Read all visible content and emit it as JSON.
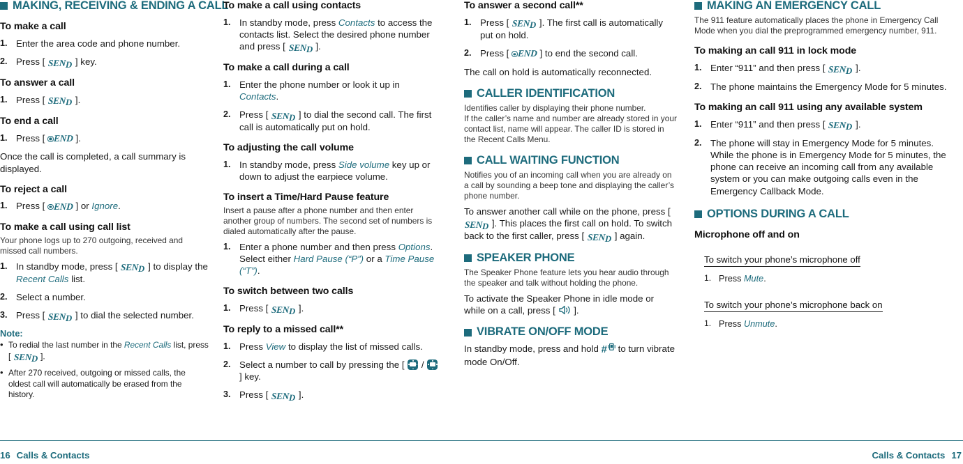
{
  "footer": {
    "page_left": "16",
    "chapter_left": "Calls & Contacts",
    "chapter_right": "Calls & Contacts",
    "page_right": "17"
  },
  "colors": {
    "accent": "#1d6b7c",
    "text": "#1a1a1a"
  },
  "col1": {
    "section_title": "MAKING, RECEIVING & ENDING A CALL",
    "h_make_call": "To make a call",
    "make_call_1": "Enter the area code and phone number.",
    "make_call_2_pre": "Press [",
    "make_call_2_post": "] key.",
    "h_answer_call": "To answer a call",
    "answer_call_1_pre": "Press [",
    "answer_call_1_post": "].",
    "h_end_call": "To end a call",
    "end_call_1_pre": "Press [",
    "end_call_1_post": "].",
    "end_call_note": "Once the call is completed, a call summary is displayed.",
    "h_reject_call": "To reject a call",
    "reject_call_1_pre": "Press [",
    "reject_call_1_mid": "] or ",
    "reject_call_1_term": "Ignore",
    "reject_call_1_post": ".",
    "h_call_list": "To make a call using call list",
    "call_list_intro": "Your phone logs up to 270 outgoing, received and missed call numbers.",
    "call_list_1_pre": "In standby mode, press [",
    "call_list_1_mid": "] to display the ",
    "call_list_1_term": "Recent Calls",
    "call_list_1_post": " list.",
    "call_list_2": "Select a number.",
    "call_list_3_pre": "Press [",
    "call_list_3_post": "] to dial the selected number.",
    "note_label": "Note:",
    "note_1_pre": "To redial the last number in the ",
    "note_1_term": "Recent Calls",
    "note_1_mid": " list, press [",
    "note_1_post": "].",
    "note_2": "After 270 received, outgoing or missed calls, the oldest call will automatically be erased from the history."
  },
  "col2": {
    "h_contacts": "To make a call using contacts",
    "contacts_1_pre": "In standby mode, press ",
    "contacts_1_term": "Contacts",
    "contacts_1_mid": " to access the contacts list. Select the desired phone number and press [",
    "contacts_1_post": "].",
    "h_during_call": "To make a call during a call",
    "during_1_pre": "Enter the phone number or look it up in ",
    "during_1_term": "Contacts",
    "during_1_post": ".",
    "during_2_pre": "Press [",
    "during_2_post": "] to dial the second call. The first call is automatically put on hold.",
    "h_volume": "To adjusting the call volume",
    "volume_1_pre": "In standby mode, press ",
    "volume_1_term": "Side volume",
    "volume_1_post": " key up or down to adjust the earpiece volume.",
    "h_pause": "To insert a Time/Hard Pause feature",
    "pause_intro": "Insert a pause after a phone number and then enter another group of numbers. The second set of numbers is dialed automatically after the pause.",
    "pause_1_pre": "Enter a phone number and then press ",
    "pause_1_term1": "Options",
    "pause_1_mid1": ". Select either ",
    "pause_1_term2": "Hard Pause (“P”)",
    "pause_1_mid2": " or a ",
    "pause_1_term3": "Time Pause (“T”)",
    "pause_1_post": ".",
    "h_switch": "To switch between two calls",
    "switch_1_pre": "Press [",
    "switch_1_post": "].",
    "h_missed": "To reply to a missed call**",
    "missed_1_pre": "Press ",
    "missed_1_term": "View",
    "missed_1_post": " to display the list of missed calls.",
    "missed_2_pre": "Select a number to call by pressing the [",
    "missed_2_sep": " / ",
    "missed_2_post": "] key.",
    "missed_3_pre": "Press [",
    "missed_3_post": "]."
  },
  "col3": {
    "h_second_call": "To answer a second call**",
    "second_1_pre": "Press [",
    "second_1_post": "]. The first call is automatically put on hold.",
    "second_2_pre": "Press [",
    "second_2_post": "] to end the second call.",
    "second_note": "The call on hold is automatically reconnected.",
    "sec_caller_id": "CALLER IDENTIFICATION",
    "caller_id_body": "Identifies caller by displaying their phone number.\nIf the caller’s name and number are already stored in your contact list, name will appear. The caller ID is stored in the Recent Calls Menu.",
    "sec_call_waiting": "CALL WAITING FUNCTION",
    "call_waiting_body": "Notifies you of an incoming call when you are already on a call by sounding a beep tone and displaying the caller’s phone number.",
    "call_waiting_p2_a": "To answer another call while on the phone, press [",
    "call_waiting_p2_b": "]. This places the first call on hold. To switch back to the first caller, press [",
    "call_waiting_p2_c": "] again.",
    "sec_speaker": "SPEAKER PHONE",
    "speaker_body": "The Speaker Phone feature lets you hear audio through the speaker and talk without holding the phone.",
    "speaker_p2_a": "To activate the Speaker Phone in idle mode or while on a call, press [",
    "speaker_p2_b": "].",
    "sec_vibrate": "VIBRATE ON/OFF MODE",
    "vibrate_a": "In standby mode, press and hold ",
    "vibrate_b": " to turn vibrate mode On/Off."
  },
  "col4": {
    "sec_emergency": "MAKING AN EMERGENCY CALL",
    "emergency_body": "The 911 feature automatically places the phone in Emergency Call Mode when you dial the preprogrammed emergency number, 911.",
    "h_lock_mode": "To making an call 911 in lock mode",
    "lock_1_pre": "Enter “911” and then press [",
    "lock_1_post": "].",
    "lock_2": "The phone maintains the Emergency Mode for 5 minutes.",
    "h_any_system": "To making an call 911 using any available system",
    "any_1_pre": "Enter “911” and then press [",
    "any_1_post": "].",
    "any_2": "The phone will stay in Emergency Mode for 5 minutes. While the phone is in Emergency Mode for 5 minutes, the phone can receive an incoming call from any available system or you can make outgoing calls even in the Emergency Callback Mode.",
    "sec_options": "OPTIONS DURING A CALL",
    "h_microphone": "Microphone off and on",
    "h_mic_off": "To switch your phone’s microphone off",
    "mic_off_1_pre": "Press ",
    "mic_off_1_term": "Mute",
    "mic_off_1_post": ".",
    "h_mic_on": "To switch your phone’s microphone back on",
    "mic_on_1_pre": "Press ",
    "mic_on_1_term": "Unmute",
    "mic_on_1_post": "."
  },
  "icons": {
    "send_key": "send-key-icon",
    "end_key": "end-key-icon",
    "nav_key": "navigation-key-icon",
    "speaker_key": "speaker-phone-icon",
    "hash_key": "hash-key-icon",
    "vibrate_key": "vibrate-icon"
  }
}
